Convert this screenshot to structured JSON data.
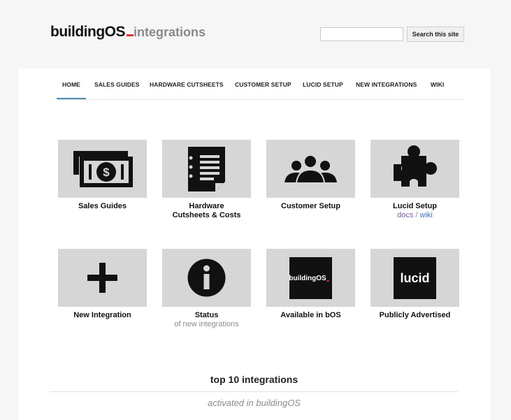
{
  "header": {
    "logo_text": "buildingOS",
    "site_name": "integrations",
    "search_placeholder": "",
    "search_button": "Search this site"
  },
  "nav": {
    "items": [
      {
        "label": "HOME",
        "active": true
      },
      {
        "label": "SALES GUIDES"
      },
      {
        "label": "HARDWARE CUTSHEETS"
      },
      {
        "label": "CUSTOMER SETUP"
      },
      {
        "label": "LUCID SETUP"
      },
      {
        "label": "NEW INTEGRATIONS"
      },
      {
        "label": "WIKI"
      }
    ]
  },
  "tiles": [
    {
      "label": "Sales Guides",
      "icon": "money-icon"
    },
    {
      "label_line1": "Hardware",
      "label_line2": "Cutsheets & Costs",
      "icon": "document-icon"
    },
    {
      "label": "Customer Setup",
      "icon": "users-icon"
    },
    {
      "label": "Lucid Setup",
      "icon": "puzzle-icon",
      "link_docs": "docs",
      "link_sep": "/",
      "link_wiki": "wiki"
    },
    {
      "label": "New Integration",
      "icon": "plus-icon"
    },
    {
      "label": "Status",
      "sub": "of new integrations",
      "icon": "info-icon"
    },
    {
      "label": "Available in bOS",
      "icon": "buildingos-logo",
      "logo_text": "buildingOS"
    },
    {
      "label": "Publicly Advertised",
      "icon": "lucid-logo",
      "logo_text": "lucid"
    }
  ],
  "top": {
    "title": "top 10 integrations",
    "subtitle": "activated in buildingOS"
  },
  "colors": {
    "accent_red": "#e23232",
    "nav_underline": "#4a8ab6",
    "tile_bg": "#d6d6d6",
    "link_docs": "#7a5aa8",
    "link_wiki": "#3b73b5"
  }
}
